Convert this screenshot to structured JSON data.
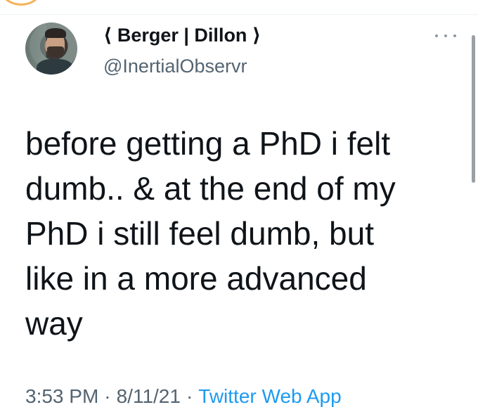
{
  "tweet": {
    "display_name": "⟨ Berger | Dillon ⟩",
    "handle": "@InertialObservr",
    "text": "before getting a PhD i felt\ndumb.. & at the end of my\nPhD i still feel dumb, but\nlike in a more advanced\nway",
    "time": "3:53 PM",
    "date": "8/11/21",
    "source": "Twitter Web App",
    "separator": "·"
  },
  "icons": {
    "more": "more-horizontal-icon",
    "avatar": "profile-photo"
  },
  "colors": {
    "text": "#0f1419",
    "secondary": "#536471",
    "link": "#1d9bf0"
  }
}
